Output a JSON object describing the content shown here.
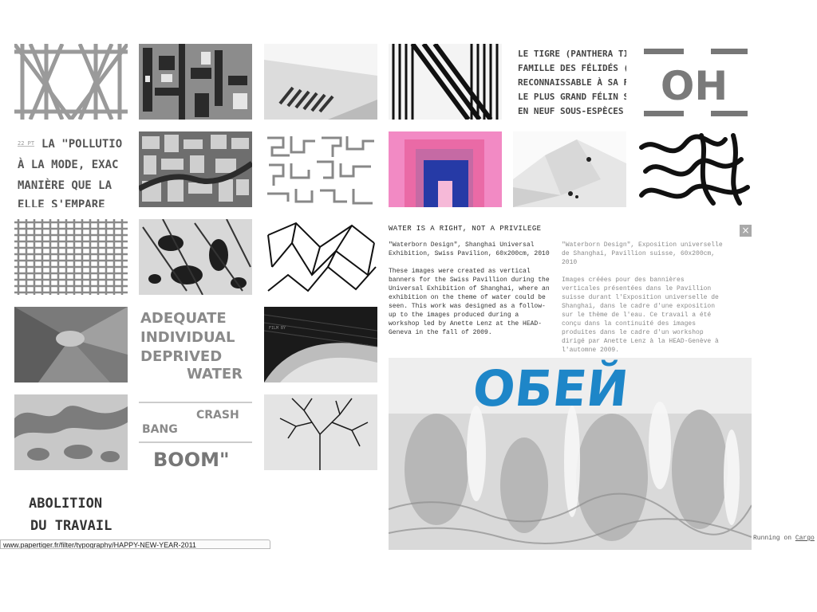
{
  "detail": {
    "title": "WATER IS A RIGHT, NOT A PRIVILEGE",
    "close_glyph": "×",
    "en": {
      "caption": "\"Waterborn Design\", Shanghai Universal Exhibition, Swiss Pavilion, 60x200cm, 2010",
      "body": "These images were created as vertical banners for the Swiss Pavillion during the Universal Exhibition of Shanghai, where an exhibition on the theme of water could be seen. This work was designed as a follow-up to the images produced during a workshop led by Anette Lenz at the HEAD-Geneva in the fall of 2009."
    },
    "fr": {
      "caption": "\"Waterborn Design\", Exposition universelle de Shanghai, Pavillion suisse, 60x200cm, 2010",
      "body": "Images créées pour des bannières verticales présentées dans le Pavillion suisse durant l'Exposition universelle de Shanghai, dans le cadre d'une exposition sur le thème de l'eau. Ce travail a été conçu dans la continuité des images produites dans le cadre d'un workshop dirigé par Anette Lenz à la HEAD-Genève à l'automne 2009."
    },
    "image_text": "ОБЕЙ"
  },
  "thumbs": {
    "t3_text": [
      "LE TIGRE (PANTHERA TIGRI",
      "FAMILLE DES FÉLIDÉS (FE",
      "RECONNAISSABLE À SA FOU",
      "LE PLUS GRAND FÉLIN SAU",
      "EN NEUF SOUS-ESPÈCES F"
    ],
    "t4_text": "OH",
    "t5_label": "22 PT",
    "t5_text": [
      "LA \"POLLUTIO",
      "À LA MODE, EXAC",
      "MANIÈRE QUE LA",
      "ELLE S'EMPARE"
    ],
    "t20_text": [
      "WATER",
      "ADEQUATE",
      "INDIVIDUAL",
      "DEPRIVED"
    ],
    "t21_text": "FILM BY",
    "t23_text": [
      "BANG",
      "CRASH",
      "BOOM\""
    ],
    "t25_text": [
      "ABOLITION",
      "DU TRAVAIL"
    ]
  },
  "footer": {
    "running_on": "Running on",
    "cargo_link": "Cargo"
  },
  "status_bar": {
    "url": "www.papertiger.fr/filter/typography/HAPPY-NEW-YEAR-2011"
  }
}
